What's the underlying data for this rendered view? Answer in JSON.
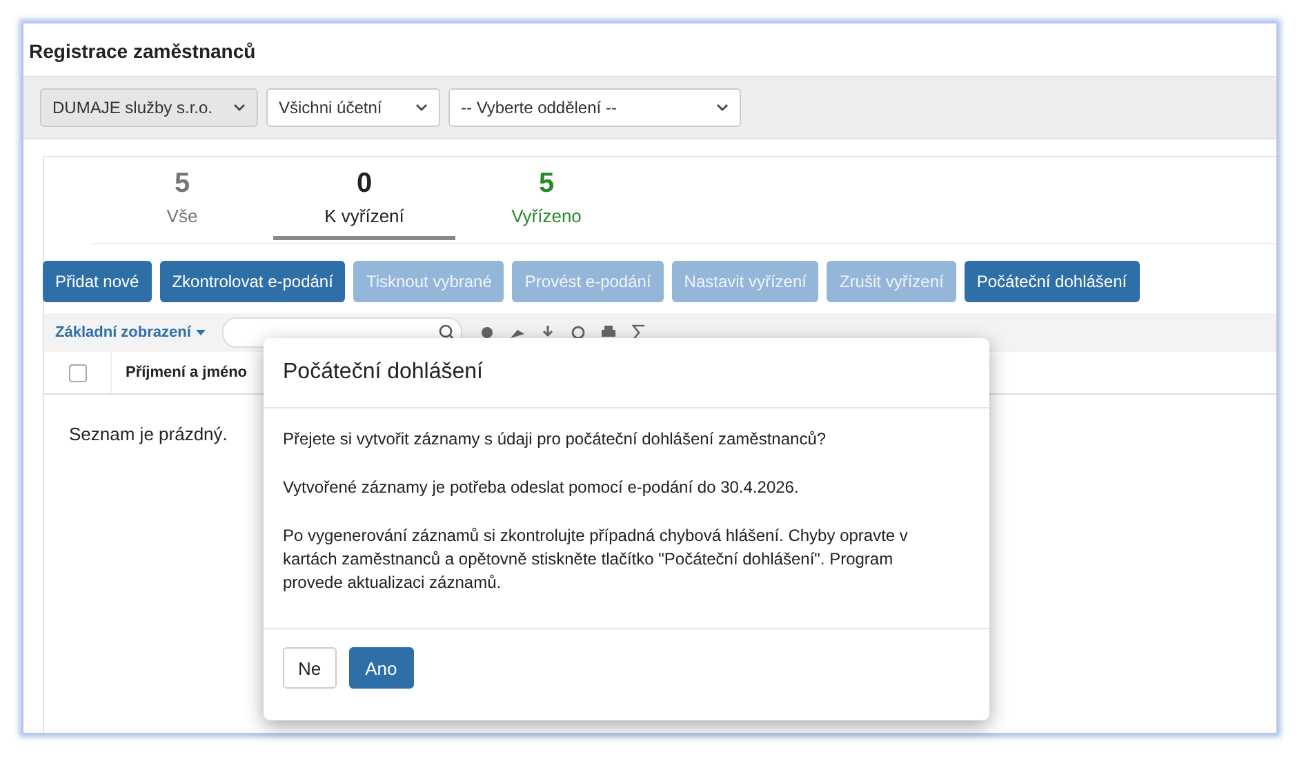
{
  "page": {
    "title": "Registrace zaměstnanců"
  },
  "filters": [
    {
      "value": "DUMAJE služby s.r.o.",
      "disabled": true
    },
    {
      "value": "Všichni účetní",
      "disabled": false
    },
    {
      "value": "-- Vyberte oddělení --",
      "disabled": false
    }
  ],
  "status_tabs": [
    {
      "count": "5",
      "label": "Vše",
      "selected": false,
      "color": "#777777"
    },
    {
      "count": "0",
      "label": "K vyřízení",
      "selected": true,
      "color": "#222222"
    },
    {
      "count": "5",
      "label": "Vyřízeno",
      "selected": false,
      "color": "#2a8a2a"
    }
  ],
  "buttons": [
    {
      "label": "Přidat nové",
      "disabled": false
    },
    {
      "label": "Zkontrolovat e-podání",
      "disabled": false
    },
    {
      "label": "Tisknout vybrané",
      "disabled": true
    },
    {
      "label": "Provést e-podání",
      "disabled": true
    },
    {
      "label": "Nastavit vyřízení",
      "disabled": true
    },
    {
      "label": "Zrušit vyřízení",
      "disabled": true
    },
    {
      "label": "Počáteční dohlášení",
      "disabled": false
    }
  ],
  "toolbar": {
    "view": "Základní zobrazení"
  },
  "table": {
    "select_all_checked": false,
    "columns": [
      "Příjmení a jméno"
    ],
    "empty_message": "Seznam je prázdný."
  },
  "dialog": {
    "title": "Počáteční dohlášení",
    "paragraphs": [
      "Přejete si vytvořit záznamy s údaji pro počáteční dohlášení zaměstnanců?",
      "Vytvořené záznamy je potřeba odeslat pomocí e-podání do 30.4.2026.",
      "Po vygenerování záznamů si zkontrolujte případná chybová hlášení. Chyby opravte v kartách zaměstnanců a opětovně stiskněte tlačítko \"Počáteční dohlášení\". Program provede aktualizaci záznamů."
    ],
    "buttons": [
      {
        "label": "Ne",
        "kind": "default"
      },
      {
        "label": "Ano",
        "kind": "primary"
      }
    ]
  }
}
